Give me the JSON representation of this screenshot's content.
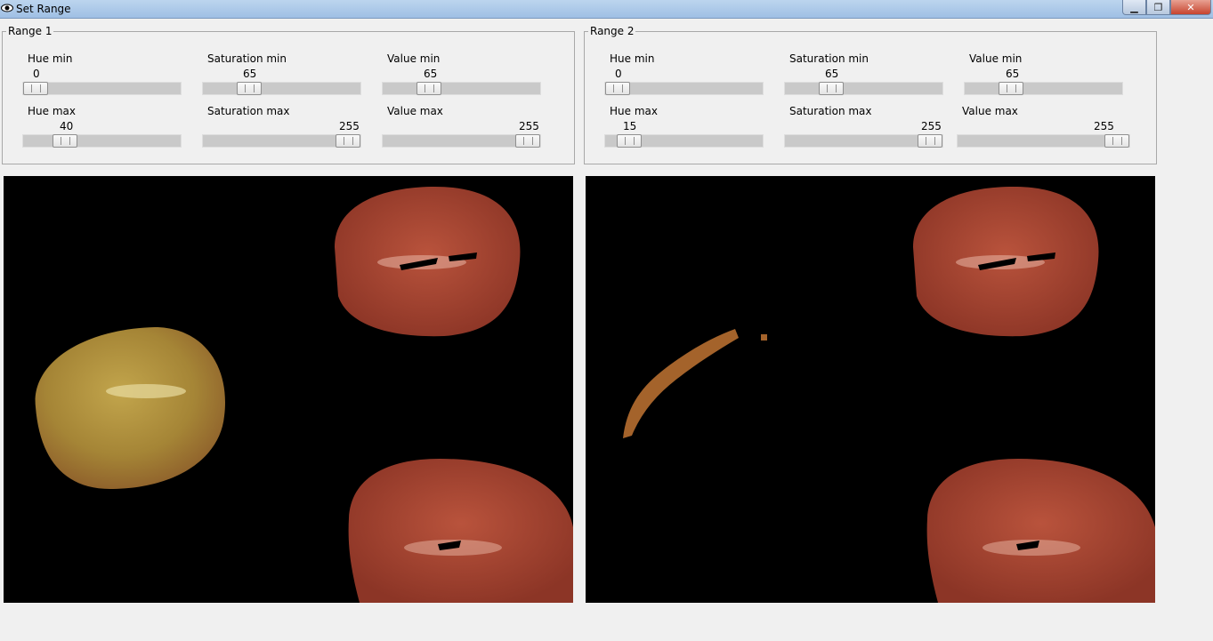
{
  "window": {
    "title": "Set Range"
  },
  "range1": {
    "legend": "Range 1",
    "hue_min": {
      "label": "Hue min",
      "value": "0"
    },
    "sat_min": {
      "label": "Saturation min",
      "value": "65"
    },
    "val_min": {
      "label": "Value min",
      "value": "65"
    },
    "hue_max": {
      "label": "Hue max",
      "value": "40"
    },
    "sat_max": {
      "label": "Saturation max",
      "value": "255"
    },
    "val_max": {
      "label": "Value max",
      "value": "255"
    }
  },
  "range2": {
    "legend": "Range 2",
    "hue_min": {
      "label": "Hue min",
      "value": "0"
    },
    "sat_min": {
      "label": "Saturation min",
      "value": "65"
    },
    "val_min": {
      "label": "Value min",
      "value": "65"
    },
    "hue_max": {
      "label": "Hue max",
      "value": "15"
    },
    "sat_max": {
      "label": "Saturation max",
      "value": "255"
    },
    "val_max": {
      "label": "Value max",
      "value": "255"
    }
  },
  "colors": {
    "fruit_red": "#a3422f",
    "fruit_yellow": "#a99b3c",
    "fruit_orange": "#a4632b",
    "mask_bg": "#000000"
  }
}
